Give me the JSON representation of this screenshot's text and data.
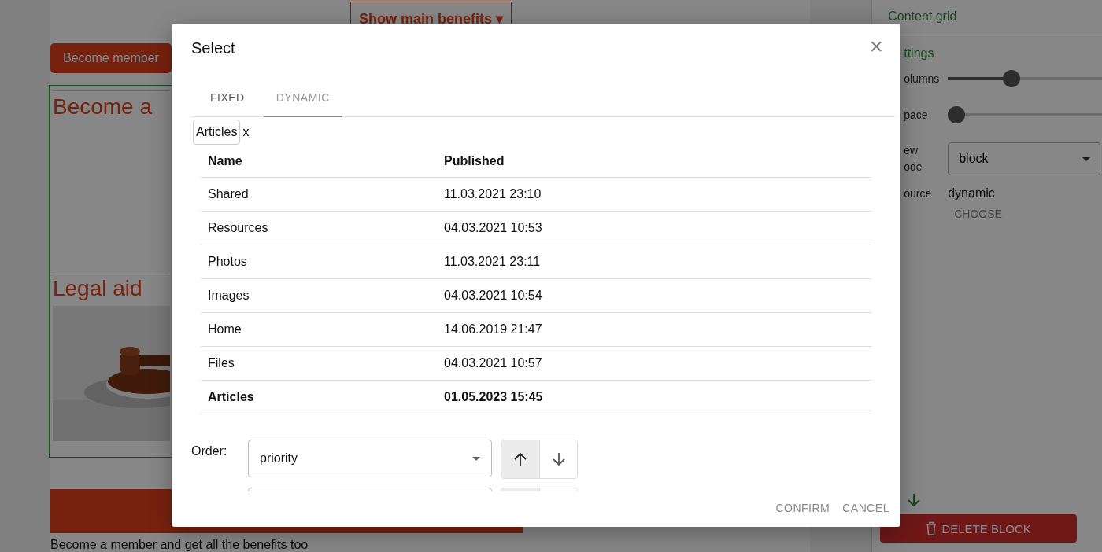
{
  "page": {
    "benefits_button": "Show main benefits ▾",
    "member_button": "Become member",
    "card_heading": "Become a",
    "section_heading": "Legal aid",
    "footer_text": "Become a member and get all the benefits too"
  },
  "panel": {
    "title": "Content grid",
    "section": "ttings",
    "sliders": [
      {
        "label": "olumns",
        "level": 0.4
      },
      {
        "label": "pace",
        "level": 0
      }
    ],
    "view_label": [
      "ew",
      "ode"
    ],
    "view_value": "block",
    "source_label": "ource",
    "source_value": "dynamic",
    "choose": "CHOOSE",
    "delete": "DELETE BLOCK"
  },
  "dialog": {
    "title": "Select",
    "close": "×",
    "tabs": [
      {
        "label": "FIXED",
        "selected": false
      },
      {
        "label": "DYNAMIC",
        "selected": true
      }
    ],
    "chips": [
      {
        "label": "Articles",
        "remove": "x"
      }
    ],
    "table": {
      "columns": [
        "Name",
        "Published"
      ],
      "rows": [
        {
          "cells": [
            "Shared",
            "11.03.2021 23:10"
          ],
          "selected": false
        },
        {
          "cells": [
            "Resources",
            "04.03.2021 10:53"
          ],
          "selected": false
        },
        {
          "cells": [
            "Photos",
            "11.03.2021 23:11"
          ],
          "selected": false
        },
        {
          "cells": [
            "Images",
            "04.03.2021 10:54"
          ],
          "selected": false
        },
        {
          "cells": [
            "Home",
            "14.06.2019 21:47"
          ],
          "selected": false
        },
        {
          "cells": [
            "Files",
            "04.03.2021 10:57"
          ],
          "selected": false
        },
        {
          "cells": [
            "Articles",
            "01.05.2023 15:45"
          ],
          "selected": true
        }
      ]
    },
    "order_label": "Order:",
    "order": [
      {
        "value": "priority",
        "ascending": true
      },
      {
        "ascending": true
      }
    ],
    "buttons": [
      "CONFIRM",
      "CANCEL"
    ]
  }
}
